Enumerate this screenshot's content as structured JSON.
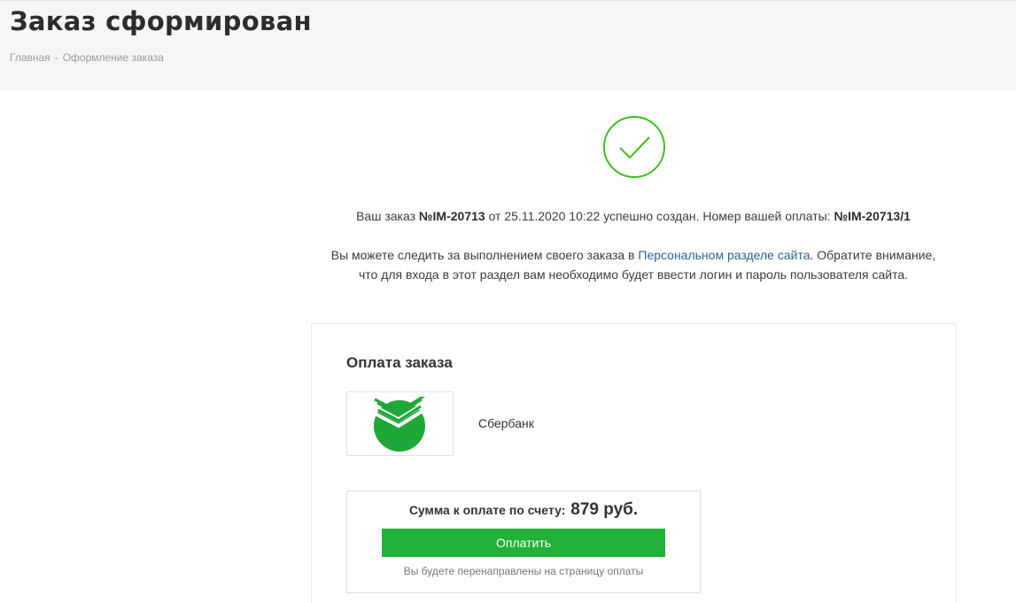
{
  "header": {
    "title": "Заказ сформирован",
    "breadcrumb": {
      "home": "Главная",
      "separator": "-",
      "current": "Оформление заказа"
    }
  },
  "success_icon": "checkmark-circle-icon",
  "order_message": {
    "before_order": "Ваш заказ ",
    "order_number": "№IM-20713",
    "middle": " от 25.11.2020 10:22 успешно создан. Номер вашей оплаты: ",
    "payment_number": "№IM-20713/1"
  },
  "tracking_message": {
    "before_link": "Вы можете следить за выполнением своего заказа в ",
    "link_text": "Персональном разделе сайта",
    "after_link": ". Обратите внимание,",
    "line2": "что для входа в этот раздел вам необходимо будет ввести логин и пароль пользователя сайта."
  },
  "payment": {
    "title": "Оплата заказа",
    "method_logo": "sberbank-logo-icon",
    "method_name": "Сбербанк",
    "sum_label": "Сумма к оплате по счету:",
    "sum_value": "879 руб.",
    "pay_button_label": "Оплатить",
    "redirect_note": "Вы будете перенаправлены на страницу оплаты"
  },
  "colors": {
    "success_green": "#3cbf1f",
    "button_green": "#21b23a",
    "link_blue": "#2a6496",
    "header_bg": "#f6f6f6"
  }
}
